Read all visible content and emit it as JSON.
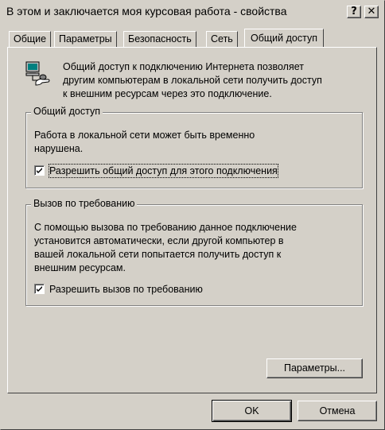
{
  "window": {
    "title": "В этом и заключается моя курсовая работа  - свойства",
    "help_label": "?",
    "close_label": "✕"
  },
  "tabs": [
    {
      "label": "Общие"
    },
    {
      "label": "Параметры"
    },
    {
      "label": "Безопасность"
    },
    {
      "label": "Сеть"
    },
    {
      "label": "Общий доступ",
      "active": true
    }
  ],
  "info": {
    "icon": "network-share-icon",
    "lines": [
      "Общий доступ к подключению Интернета позволяет",
      "другим компьютерам в локальной сети получить доступ",
      "к внешним ресурсам через это подключение."
    ]
  },
  "sharing_group": {
    "title": "Общий доступ",
    "lines": [
      "Работа в локальной сети может быть временно",
      "нарушена."
    ],
    "checkbox_label": "Разрешить общий доступ для этого подключения",
    "checked": true
  },
  "ondemand_group": {
    "title": "Вызов по требованию",
    "lines": [
      "С помощью вызова по требованию данное подключение",
      "установится автоматически, если другой компьютер в",
      "вашей локальной сети попытается получить доступ к",
      "внешним ресурсам."
    ],
    "checkbox_label": "Разрешить вызов по требованию",
    "checked": true
  },
  "buttons": {
    "settings": "Параметры...",
    "ok": "OK",
    "cancel": "Отмена"
  }
}
